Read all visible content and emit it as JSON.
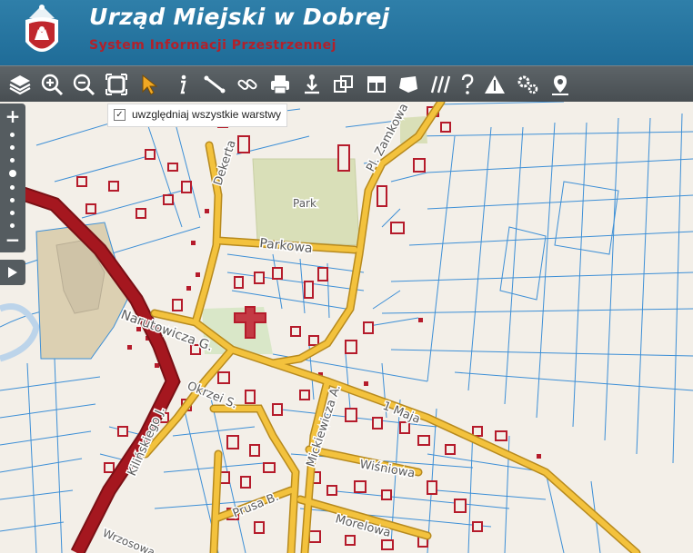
{
  "header": {
    "title": "Urząd Miejski w Dobrej",
    "subtitle": "System Informacji Przestrzennej",
    "crest_icon": "coat-of-arms-crest"
  },
  "toolbar": {
    "tools": [
      {
        "name": "layers-icon"
      },
      {
        "name": "zoom-in-icon"
      },
      {
        "name": "zoom-out-icon"
      },
      {
        "name": "full-extent-icon"
      },
      {
        "name": "select-pointer-icon"
      },
      {
        "name": "info-icon"
      },
      {
        "name": "measure-distance-icon"
      },
      {
        "name": "link-icon"
      },
      {
        "name": "print-icon"
      },
      {
        "name": "download-icon"
      },
      {
        "name": "copy-icon"
      },
      {
        "name": "layout-icon"
      },
      {
        "name": "measure-area-icon"
      },
      {
        "name": "hatch-icon"
      },
      {
        "name": "help-icon"
      },
      {
        "name": "triangle-tool-icon"
      },
      {
        "name": "settings-icon"
      },
      {
        "name": "location-pin-icon"
      }
    ]
  },
  "layer_toggle": {
    "checked": true,
    "label": "uwzględniaj wszystkie warstwy"
  },
  "zoom": {
    "plus": "+",
    "minus": "−",
    "level_steps": 7
  },
  "map": {
    "colors": {
      "background": "#f3efe8",
      "parcel_lines": "#3d8fd6",
      "buildings": "#b51b2b",
      "main_road": "#a5171f",
      "secondary_road": "#f3c23d",
      "park": "#d9dfb8"
    },
    "labels": {
      "park": "Park",
      "parkowa": "Parkowa",
      "dekerta": "Dekerta",
      "zamkowa": "Pl. Zamkowa",
      "narutowicza": "Narutowicza G.",
      "okrzei": "Okrzei S.",
      "maja": "1 Maja",
      "mickiewicza": "Mickiewicza A.",
      "wisniowa": "Wiśniowa",
      "kilinskiego": "Kilińskiego J.",
      "prusa": "Prusa B.",
      "morelowa": "Morelowa",
      "wrzosowa": "Wrzosowa"
    }
  }
}
